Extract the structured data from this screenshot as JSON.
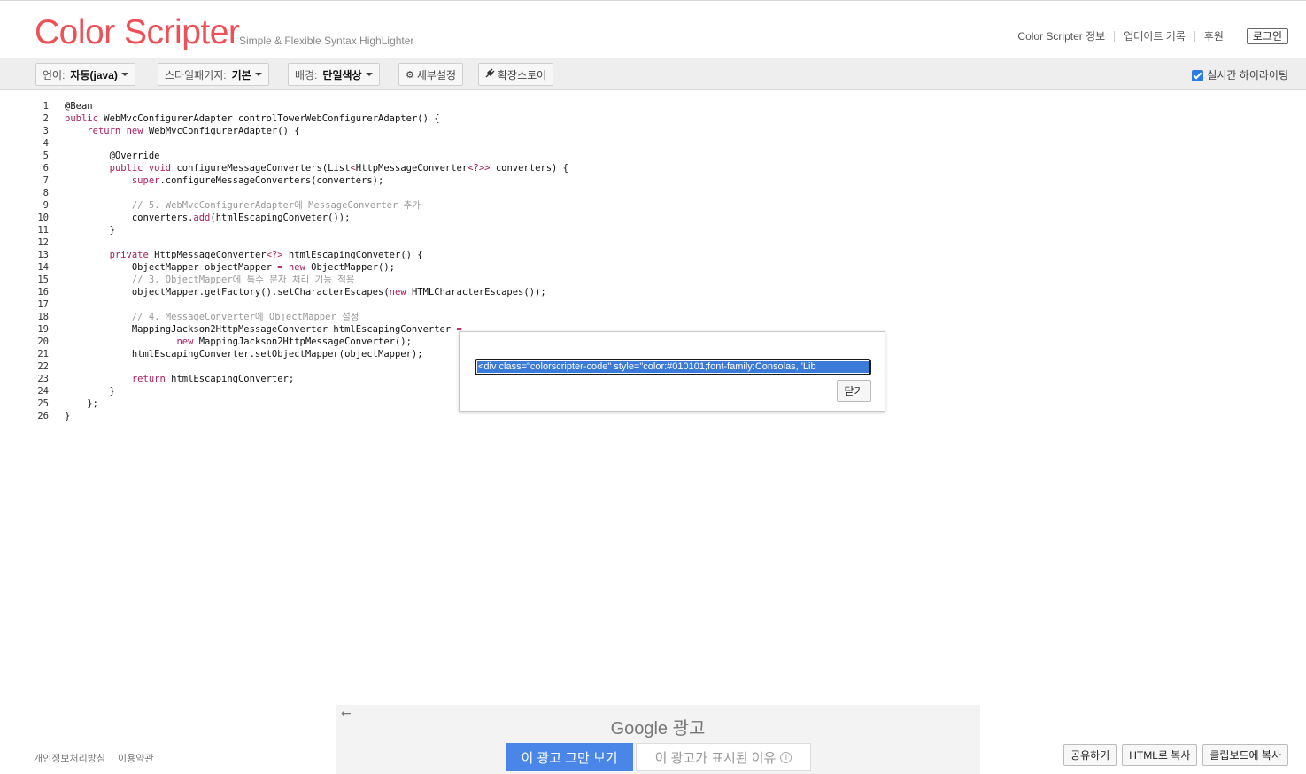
{
  "header": {
    "logo": "Color Scripter",
    "tagline": "Simple & Flexible Syntax HighLighter",
    "nav": [
      "Color Scripter 정보",
      "업데이트 기록",
      "후원"
    ],
    "login": "로그인"
  },
  "toolbar": {
    "language_label": "언어:",
    "language_value": "자동(java)",
    "style_label": "스타일패키지:",
    "style_value": "기본",
    "background_label": "배경:",
    "background_value": "단일색상",
    "settings": "세부설정",
    "extension_store": "확장스토어",
    "realtime_label": "실시간 하이라이팅",
    "realtime_checked": true
  },
  "editor": {
    "lines": [
      [
        {
          "t": "@Bean",
          "c": ""
        }
      ],
      [
        {
          "t": "public",
          "c": "kw"
        },
        {
          "t": " WebMvcConfigurerAdapter controlTowerWebConfigurerAdapter() {",
          "c": ""
        }
      ],
      [
        {
          "t": "    ",
          "c": ""
        },
        {
          "t": "return",
          "c": "kw"
        },
        {
          "t": " ",
          "c": ""
        },
        {
          "t": "new",
          "c": "kw"
        },
        {
          "t": " WebMvcConfigurerAdapter() {",
          "c": ""
        }
      ],
      [
        {
          "t": "",
          "c": ""
        }
      ],
      [
        {
          "t": "        @Override",
          "c": ""
        }
      ],
      [
        {
          "t": "        ",
          "c": ""
        },
        {
          "t": "public",
          "c": "kw"
        },
        {
          "t": " ",
          "c": ""
        },
        {
          "t": "void",
          "c": "kw"
        },
        {
          "t": " configureMessageConverters(List",
          "c": ""
        },
        {
          "t": "<",
          "c": "kw"
        },
        {
          "t": "HttpMessageConverter",
          "c": ""
        },
        {
          "t": "<?>>",
          "c": "kw"
        },
        {
          "t": " converters) {",
          "c": ""
        }
      ],
      [
        {
          "t": "            ",
          "c": ""
        },
        {
          "t": "super",
          "c": "kw"
        },
        {
          "t": ".configureMessageConverters(converters);",
          "c": ""
        }
      ],
      [
        {
          "t": "",
          "c": ""
        }
      ],
      [
        {
          "t": "            ",
          "c": ""
        },
        {
          "t": "// 5. WebMvcConfigurerAdapter에 MessageConverter 추가",
          "c": "cm"
        }
      ],
      [
        {
          "t": "            converters.",
          "c": ""
        },
        {
          "t": "add",
          "c": "kw"
        },
        {
          "t": "(htmlEscapingConveter());",
          "c": ""
        }
      ],
      [
        {
          "t": "        }",
          "c": ""
        }
      ],
      [
        {
          "t": "",
          "c": ""
        }
      ],
      [
        {
          "t": "        ",
          "c": ""
        },
        {
          "t": "private",
          "c": "kw"
        },
        {
          "t": " HttpMessageConverter",
          "c": ""
        },
        {
          "t": "<?>",
          "c": "kw"
        },
        {
          "t": " htmlEscapingConveter() {",
          "c": ""
        }
      ],
      [
        {
          "t": "            ObjectMapper objectMapper ",
          "c": ""
        },
        {
          "t": "=",
          "c": "kw"
        },
        {
          "t": " ",
          "c": ""
        },
        {
          "t": "new",
          "c": "kw"
        },
        {
          "t": " ObjectMapper();",
          "c": ""
        }
      ],
      [
        {
          "t": "            ",
          "c": ""
        },
        {
          "t": "// 3. ObjectMapper에 특수 문자 처리 기능 적용",
          "c": "cm"
        }
      ],
      [
        {
          "t": "            objectMapper.getFactory().setCharacterEscapes(",
          "c": ""
        },
        {
          "t": "new",
          "c": "kw"
        },
        {
          "t": " HTMLCharacterEscapes());",
          "c": ""
        }
      ],
      [
        {
          "t": "",
          "c": ""
        }
      ],
      [
        {
          "t": "            ",
          "c": ""
        },
        {
          "t": "// 4. MessageConverter에 ObjectMapper 설정",
          "c": "cm"
        }
      ],
      [
        {
          "t": "            MappingJackson2HttpMessageConverter htmlEscapingConverter ",
          "c": ""
        },
        {
          "t": "=",
          "c": "kw"
        }
      ],
      [
        {
          "t": "                    ",
          "c": ""
        },
        {
          "t": "new",
          "c": "kw"
        },
        {
          "t": " MappingJackson2HttpMessageConverter();",
          "c": ""
        }
      ],
      [
        {
          "t": "            htmlEscapingConverter.setObjectMapper(objectMapper);",
          "c": ""
        }
      ],
      [
        {
          "t": "",
          "c": ""
        }
      ],
      [
        {
          "t": "            ",
          "c": ""
        },
        {
          "t": "return",
          "c": "kw"
        },
        {
          "t": " htmlEscapingConverter;",
          "c": ""
        }
      ],
      [
        {
          "t": "        }",
          "c": ""
        }
      ],
      [
        {
          "t": "    };",
          "c": ""
        }
      ],
      [
        {
          "t": "}",
          "c": ""
        }
      ]
    ]
  },
  "dialog": {
    "html_value": "<div class=\"colorscripter-code\" style=\"color:#010101;font-family:Consolas, 'Lib",
    "close": "닫기"
  },
  "footer": {
    "links": [
      "개인정보처리방침",
      "이용약관"
    ],
    "buttons": [
      "공유하기",
      "HTML로 복사",
      "클립보드에 복사"
    ]
  },
  "ad": {
    "back": "←",
    "title": "Google 광고",
    "stop": "이 광고 그만 보기",
    "why": "이 광고가 표시된 이유",
    "info": "i"
  },
  "colors": {
    "logo": "#ee5058",
    "keyword": "#a71d5d",
    "comment": "#999999",
    "selection": "#3b7ad6",
    "ad_button": "#4a86e8",
    "toolbar_bg": "#eeeeee"
  }
}
